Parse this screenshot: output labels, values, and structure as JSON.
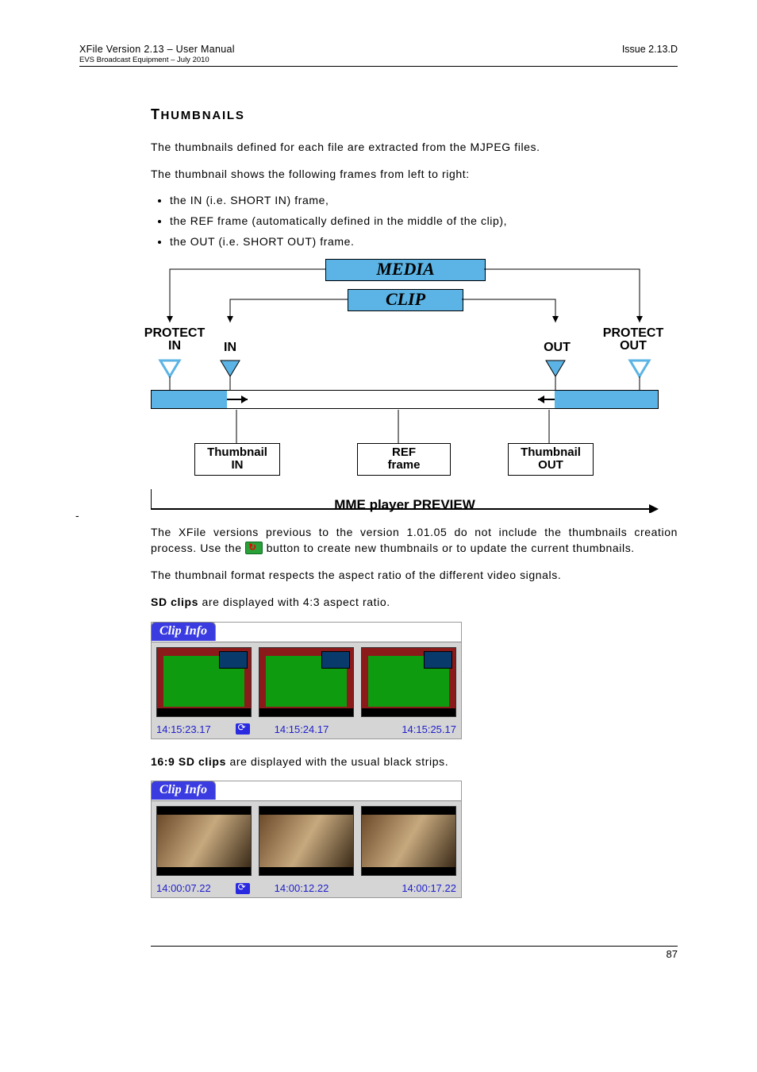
{
  "header": {
    "doc_title_left": "XFile Version 2.13 – User Manual",
    "doc_subtitle_left": "EVS Broadcast Equipment – July 2010",
    "issue_right": "Issue 2.13.D"
  },
  "section": {
    "heading_first": "T",
    "heading_rest": "HUMBNAILS",
    "p1": "The thumbnails defined for each file are extracted from the MJPEG files.",
    "p2": "The thumbnail shows the following frames from left to right:",
    "bullets": [
      "the IN (i.e. SHORT IN) frame,",
      "the REF frame (automatically defined in the middle of the clip),",
      "the OUT (i.e. SHORT OUT) frame."
    ],
    "p3a": "The XFile versions previous to the version 1.01.05 do not include the thumbnails creation process. Use the ",
    "p3b": " button to create new thumbnails or to update the current thumbnails.",
    "p4": "The thumbnail format respects the aspect ratio of the different video signals.",
    "p5_b": "SD clips",
    "p5_rest": " are displayed with 4:3 aspect ratio.",
    "p6_b": "16:9 SD clips",
    "p6_rest": " are displayed with the usual black strips."
  },
  "diagram": {
    "media": "MEDIA",
    "clip": "CLIP",
    "protect_in": "PROTECT\nIN",
    "in": "IN",
    "out": "OUT",
    "protect_out": "PROTECT\nOUT",
    "thumb_in": "Thumbnail\nIN",
    "ref_frame": "REF\nframe",
    "thumb_out": "Thumbnail\nOUT",
    "mme": "MME player PREVIEW"
  },
  "clipinfo": {
    "tab": "Clip Info",
    "sd": {
      "tc_in": "14:15:23.17",
      "tc_ref": "14:15:24.17",
      "tc_out": "14:15:25.17"
    },
    "hd": {
      "tc_in": "14:00:07.22",
      "tc_ref": "14:00:12.22",
      "tc_out": "14:00:17.22"
    }
  },
  "page_number": "87",
  "dash": "-"
}
